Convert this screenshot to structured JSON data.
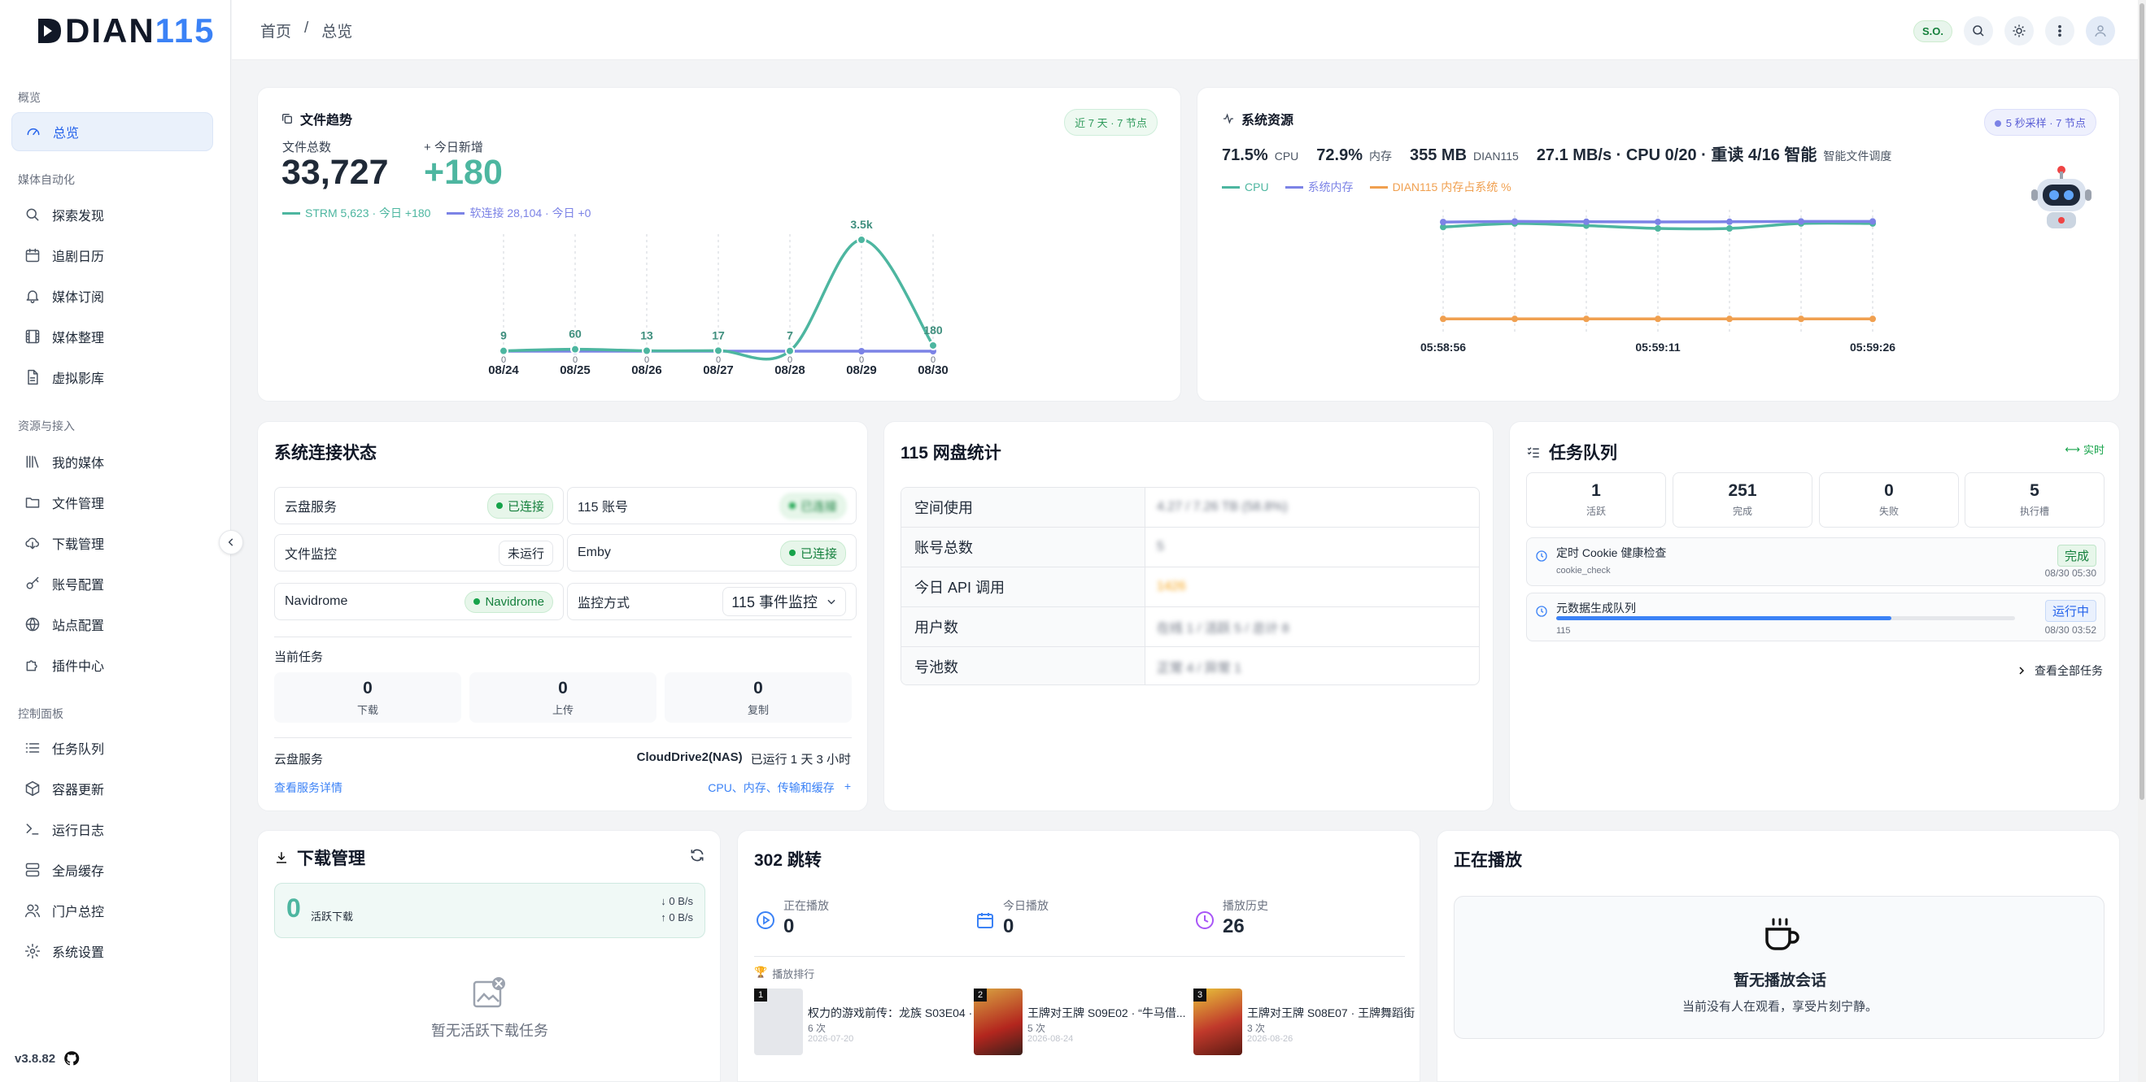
{
  "app": {
    "logo_a": "DIAN",
    "logo_b": "115",
    "version": "v3.8.82"
  },
  "sidebar": {
    "sections": [
      "概览",
      "媒体自动化",
      "资源与接入",
      "控制面板"
    ],
    "items": [
      {
        "label": "总览",
        "icon": "gauge-icon"
      },
      {
        "label": "探索发现",
        "icon": "search-icon"
      },
      {
        "label": "追剧日历",
        "icon": "calendar-icon"
      },
      {
        "label": "媒体订阅",
        "icon": "bell-icon"
      },
      {
        "label": "媒体整理",
        "icon": "film-icon"
      },
      {
        "label": "虚拟影库",
        "icon": "file-icon"
      },
      {
        "label": "我的媒体",
        "icon": "library-icon"
      },
      {
        "label": "文件管理",
        "icon": "folder-icon"
      },
      {
        "label": "下载管理",
        "icon": "cloud-download-icon"
      },
      {
        "label": "账号配置",
        "icon": "key-icon"
      },
      {
        "label": "站点配置",
        "icon": "globe-icon"
      },
      {
        "label": "插件中心",
        "icon": "puzzle-icon"
      },
      {
        "label": "任务队列",
        "icon": "list-icon"
      },
      {
        "label": "容器更新",
        "icon": "box-icon"
      },
      {
        "label": "运行日志",
        "icon": "terminal-icon"
      },
      {
        "label": "全局缓存",
        "icon": "server-icon"
      },
      {
        "label": "门户总控",
        "icon": "users-icon"
      },
      {
        "label": "系统设置",
        "icon": "gear-icon"
      }
    ]
  },
  "topbar": {
    "crumb_home": "首页",
    "crumb_sep": "/",
    "crumb_current": "总览",
    "user_badge": "S.O."
  },
  "file_trend": {
    "title": "文件趋势",
    "pill": "近 7 天 · 7 节点",
    "total_label": "文件总数",
    "total": "33,727",
    "today_label": "+ 今日新增",
    "today": "+180",
    "legend_strm": "STRM 5,623 · 今日 +180",
    "legend_link": "软连接 28,104 · 今日 +0"
  },
  "sys_res": {
    "title": "系统资源",
    "pill": "5 秒采样 · 7 节点",
    "cpu_v": "71.5%",
    "cpu_l": "CPU",
    "mem_v": "72.9%",
    "mem_l": "内存",
    "d_v": "355 MB",
    "d_l": "DIAN115",
    "io_v": "27.1 MB/s · CPU 0/20 · 重读 4/16 智能",
    "io_l": "智能文件调度",
    "legend": [
      "CPU",
      "系统内存",
      "DIAN115 内存占系统 %"
    ]
  },
  "conn": {
    "title": "系统连接状态",
    "rows": [
      {
        "k": "云盘服务",
        "v": "已连接"
      },
      {
        "k": "115 账号",
        "v": "已连接"
      },
      {
        "k": "文件监控",
        "v": "未运行"
      },
      {
        "k": "Emby",
        "v": "已连接"
      },
      {
        "k": "Navidrome",
        "v": "Navidrome"
      },
      {
        "k": "监控方式",
        "v": "115 事件监控"
      }
    ],
    "cur_task": "当前任务",
    "stats": [
      {
        "v": "0",
        "l": "下载"
      },
      {
        "v": "0",
        "l": "上传"
      },
      {
        "v": "0",
        "l": "复制"
      }
    ],
    "cloud_label": "云盘服务",
    "cloud_val": "CloudDrive2(NAS)",
    "cloud_up": "已运行 1 天 3 小时",
    "detail_link": "查看服务详情",
    "res_link": "CPU、内存、传输和缓存",
    "res_plus": "+"
  },
  "pan": {
    "title": "115 网盘统计",
    "rows": [
      {
        "k": "空间使用",
        "v": "4.27 / 7.26 TB (58.8%)"
      },
      {
        "k": "账号总数",
        "v": "5"
      },
      {
        "k": "今日 API 调用",
        "v": "1426"
      },
      {
        "k": "用户数",
        "v": "在线 1 / 活跃 5 / 总计 8"
      },
      {
        "k": "号池数",
        "v": "正常 4 / 异常 1"
      }
    ]
  },
  "queue": {
    "title": "任务队列",
    "live": "实时",
    "stats": [
      {
        "v": "1",
        "l": "活跃"
      },
      {
        "v": "251",
        "l": "完成"
      },
      {
        "v": "0",
        "l": "失败"
      },
      {
        "v": "5",
        "l": "执行槽"
      }
    ],
    "tasks": [
      {
        "name": "定时 Cookie 健康检查",
        "sub": "cookie_check",
        "status": "完成",
        "time": "08/30 05:30"
      },
      {
        "name": "元数据生成队列",
        "sub": "115",
        "status": "运行中",
        "time": "08/30 03:52"
      }
    ],
    "progress": 0.73,
    "view_all": "查看全部任务"
  },
  "download": {
    "title": "下载管理",
    "active_count": "0",
    "active_label": "活跃下载",
    "down_speed": "↓ 0 B/s",
    "up_speed": "↑ 0 B/s",
    "empty": "暂无活跃下载任务"
  },
  "redirect": {
    "title": "302 跳转",
    "stats": [
      {
        "l": "正在播放",
        "v": "0"
      },
      {
        "l": "今日播放",
        "v": "0"
      },
      {
        "l": "播放历史",
        "v": "26"
      }
    ],
    "rank_title": "播放排行",
    "items": [
      {
        "rank": "1",
        "title": "权力的游戏前传：龙族 S03E04 · ...",
        "count": "6 次",
        "date": "2026-07-20"
      },
      {
        "rank": "2",
        "title": "王牌对王牌 S09E02 · “牛马借...",
        "count": "5 次",
        "date": "2026-08-24"
      },
      {
        "rank": "3",
        "title": "王牌对王牌 S08E07 · 王牌舞蹈街",
        "count": "3 次",
        "date": "2026-08-26"
      }
    ]
  },
  "now_playing": {
    "title": "正在播放",
    "empty_title": "暂无播放会话",
    "empty_sub": "当前没有人在观看，享受片刻宁静。"
  },
  "chart_data": [
    {
      "type": "line",
      "title": "文件趋势",
      "categories": [
        "08/24",
        "08/25",
        "08/26",
        "08/27",
        "08/28",
        "08/29",
        "08/30"
      ],
      "series": [
        {
          "name": "STRM",
          "values": [
            9,
            60,
            13,
            17,
            7,
            3500,
            180
          ],
          "color": "#4db6a0"
        },
        {
          "name": "软连接",
          "values": [
            0,
            0,
            0,
            0,
            0,
            0,
            0
          ],
          "color": "#7c83e6"
        }
      ],
      "data_labels": [
        "9",
        "60",
        "13",
        "17",
        "7",
        "3.5k",
        "180"
      ]
    },
    {
      "type": "line",
      "title": "系统资源",
      "x": [
        "05:58:56",
        "",
        "",
        "05:59:11",
        "",
        "",
        "05:59:26"
      ],
      "series": [
        {
          "name": "CPU",
          "values": [
            69,
            71.5,
            70,
            68,
            68,
            71.5,
            71.5
          ],
          "color": "#4db6a0"
        },
        {
          "name": "系统内存",
          "values": [
            72.5,
            72.9,
            72.7,
            72.6,
            72.7,
            72.9,
            72.9
          ],
          "color": "#7c83e6"
        },
        {
          "name": "DIAN115 内存占系统 %",
          "values": [
            4.4,
            4.4,
            4.4,
            4.4,
            4.4,
            4.4,
            4.4
          ],
          "color": "#f0a050"
        }
      ]
    }
  ],
  "colors": {
    "accent": "#2563eb",
    "green": "#4db6a0",
    "purple": "#7c83e6",
    "orange": "#f0a050"
  }
}
